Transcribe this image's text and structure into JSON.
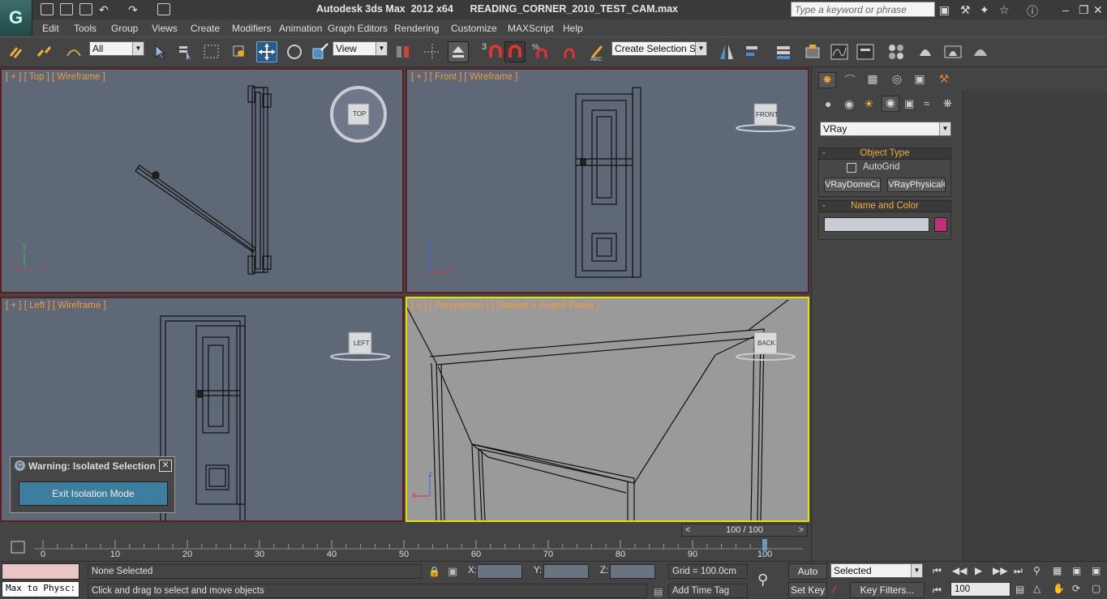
{
  "window": {
    "title": "Autodesk 3ds Max  2012 x64      READING_CORNER_2010_TEST_CAM.max",
    "search_placeholder": "Type a keyword or phrase"
  },
  "menu": [
    "Edit",
    "Tools",
    "Group",
    "Views",
    "Create",
    "Modifiers",
    "Animation",
    "Graph Editors",
    "Rendering",
    "Customize",
    "MAXScript",
    "Help"
  ],
  "toolbar": {
    "selection_filter": "All",
    "reference_coord": "View",
    "named_selection": "Create Selection Se",
    "snap_number": "3"
  },
  "viewports": {
    "top": {
      "label": "[ + ] [ Top ] [ Wireframe ]",
      "viewcube": "TOP"
    },
    "front": {
      "label": "[ + ] [ Front ] [ Wireframe ]",
      "viewcube": "FRONT"
    },
    "left": {
      "label": "[ + ] [ Left ] [ Wireframe ]",
      "viewcube": "LEFT"
    },
    "perspective": {
      "label": "[ + ] [ Perspective ] [ Shaded + Edged Faces ]",
      "viewcube": "BACK"
    }
  },
  "axes": {
    "x": "x",
    "y": "y",
    "z": "z"
  },
  "command_panel": {
    "category": "VRay",
    "object_type_title": "Object Type",
    "autogrid_label": "AutoGrid",
    "camera_buttons": [
      "VRayDomeCamera",
      "VRayPhysicalCamera"
    ],
    "name_color_title": "Name and Color",
    "name_value": "",
    "color": "#c0307a"
  },
  "warning": {
    "title": "Warning: Isolated Selection",
    "button": "Exit Isolation Mode"
  },
  "timeline": {
    "frame_display": "100 / 100",
    "ticks": [
      0,
      10,
      20,
      30,
      40,
      50,
      60,
      70,
      80,
      90,
      100
    ]
  },
  "status": {
    "maxscript_listener": "Max to Physc:",
    "selection_info": "None Selected",
    "prompt": "Click and drag to select and move objects",
    "x_label": "X:",
    "y_label": "Y:",
    "z_label": "Z:",
    "grid": "Grid = 100.0cm",
    "add_time_tag": "Add Time Tag",
    "auto_key": "Auto Key",
    "set_key": "Set Key",
    "key_mode": "Selected",
    "key_filters": "Key Filters...",
    "current_frame": "100"
  }
}
